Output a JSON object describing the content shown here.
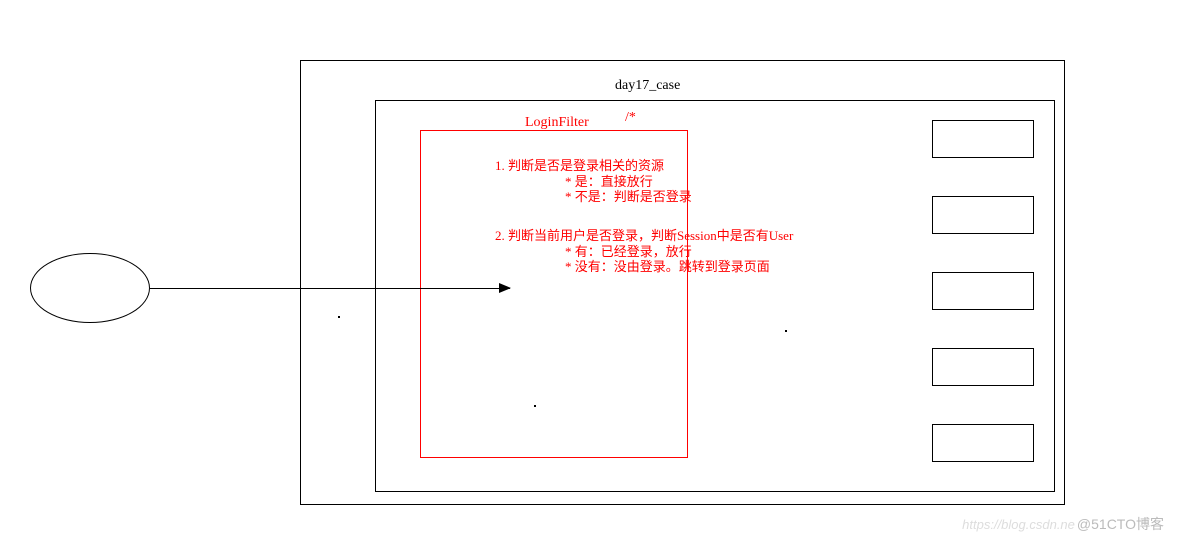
{
  "outer_label": "day17_case",
  "filter_label": "LoginFilter",
  "slash_star": "/*",
  "section1": {
    "title": "1. 判断是否是登录相关的资源",
    "line1": "* 是：直接放行",
    "line2": "* 不是：判断是否登录"
  },
  "section2": {
    "title": "2. 判断当前用户是否登录，判断Session中是否有User",
    "line1": "* 有：已经登录，放行",
    "line2": "* 没有：没由登录。跳转到登录页面"
  },
  "watermark": {
    "csdn": "https://blog.csdn.ne",
    "cto": "@51CTO博客"
  }
}
